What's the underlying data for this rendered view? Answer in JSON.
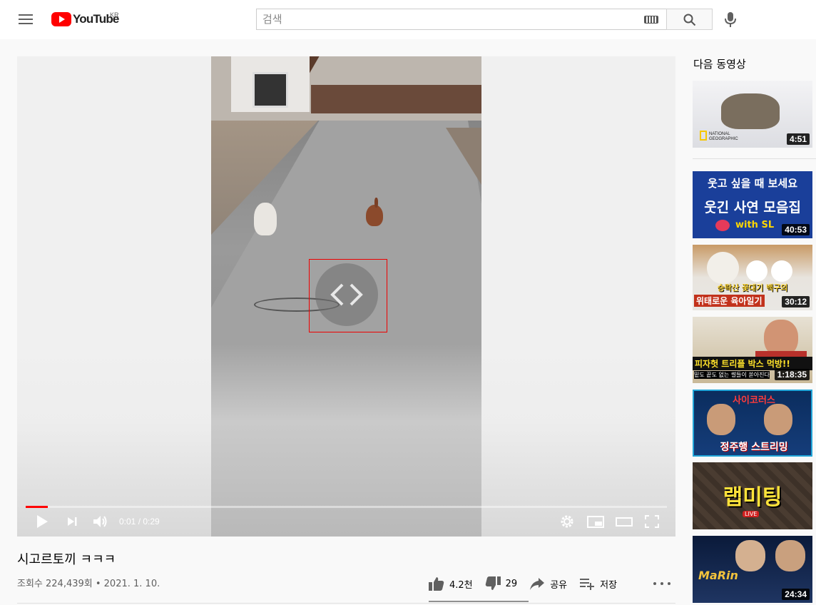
{
  "masthead": {
    "logo_text": "YouTube",
    "region": "KR",
    "search_placeholder": "검색"
  },
  "player": {
    "current_time": "0:01",
    "duration": "0:29",
    "time_display": "0:01 / 0:29",
    "progress_fraction": 0.034
  },
  "video": {
    "title": "시고르토끼 ㅋㅋㅋ",
    "meta": "조회수 224,439회 • 2021. 1. 10.",
    "likes": "4.2천",
    "dislikes": "29",
    "share_label": "공유",
    "save_label": "저장"
  },
  "sidebar": {
    "heading": "다음 동영상",
    "items": [
      {
        "duration": "4:51",
        "badge": "NATIONAL GEOGRAPHIC"
      },
      {
        "duration": "40:53",
        "line1": "웃고 싶을 때 보세요",
        "line2": "웃긴 사연 모음집",
        "tag": "with SL"
      },
      {
        "duration": "30:12",
        "line1": "승락산 꽃대기 백구의",
        "line2": "위태로운 육아일기"
      },
      {
        "duration": "1:18:35",
        "line1": "피자헛 트리플 박스 먹방!!",
        "line2": "밑도 끝도 없는 썰들이 쏟아진다"
      },
      {
        "duration": "",
        "line1": "사이코러스",
        "line2": "정주행 스트리밍"
      },
      {
        "duration": "",
        "line1": "랩미팅",
        "tag": "LIVE"
      },
      {
        "duration": "24:34",
        "line1": "MaRin"
      }
    ]
  },
  "colors": {
    "accent_red": "#ff0000",
    "text_primary": "#030303",
    "text_secondary": "#606060"
  }
}
